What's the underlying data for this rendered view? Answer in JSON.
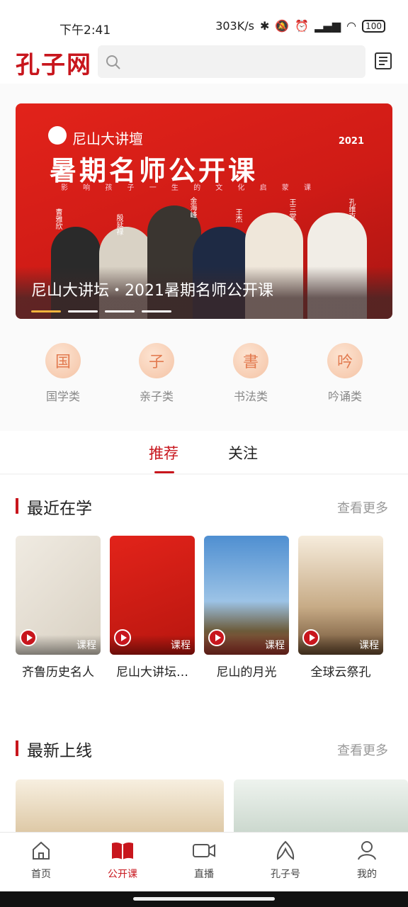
{
  "status": {
    "time": "下午2:41",
    "speed": "303K/s",
    "battery": "100"
  },
  "header": {
    "logo": "孔子网"
  },
  "banner": {
    "brand": "尼山大讲壇",
    "year": "2021",
    "headline": "暑期名师公开课",
    "subline": "影 响 孩 子 一 生 的 文 化 启 蒙 课",
    "caption": "尼山大讲坛・2021暑期名师公开课",
    "people": [
      "曹雅欣",
      "殷延禄",
      "金海峰",
      "王杰",
      "王三堂",
      "孔维克"
    ]
  },
  "categories": [
    {
      "label": "国学类",
      "glyph": "国"
    },
    {
      "label": "亲子类",
      "glyph": "子"
    },
    {
      "label": "书法类",
      "glyph": "書"
    },
    {
      "label": "吟诵类",
      "glyph": "吟"
    }
  ],
  "tabs": {
    "recommend": "推荐",
    "follow": "关注"
  },
  "recent": {
    "title": "最近在学",
    "more": "查看更多",
    "items": [
      {
        "name": "齐鲁历史名人",
        "tag": "课程"
      },
      {
        "name": "尼山大讲坛…",
        "tag": "课程"
      },
      {
        "name": "尼山的月光",
        "tag": "课程"
      },
      {
        "name": "全球云祭孔",
        "tag": "课程"
      }
    ]
  },
  "latest": {
    "title": "最新上线",
    "more": "查看更多"
  },
  "nav": [
    {
      "label": "首页"
    },
    {
      "label": "公开课"
    },
    {
      "label": "直播"
    },
    {
      "label": "孔子号"
    },
    {
      "label": "我的"
    }
  ],
  "colors": {
    "accent": "#c8161d",
    "gold": "#f2b43c"
  }
}
